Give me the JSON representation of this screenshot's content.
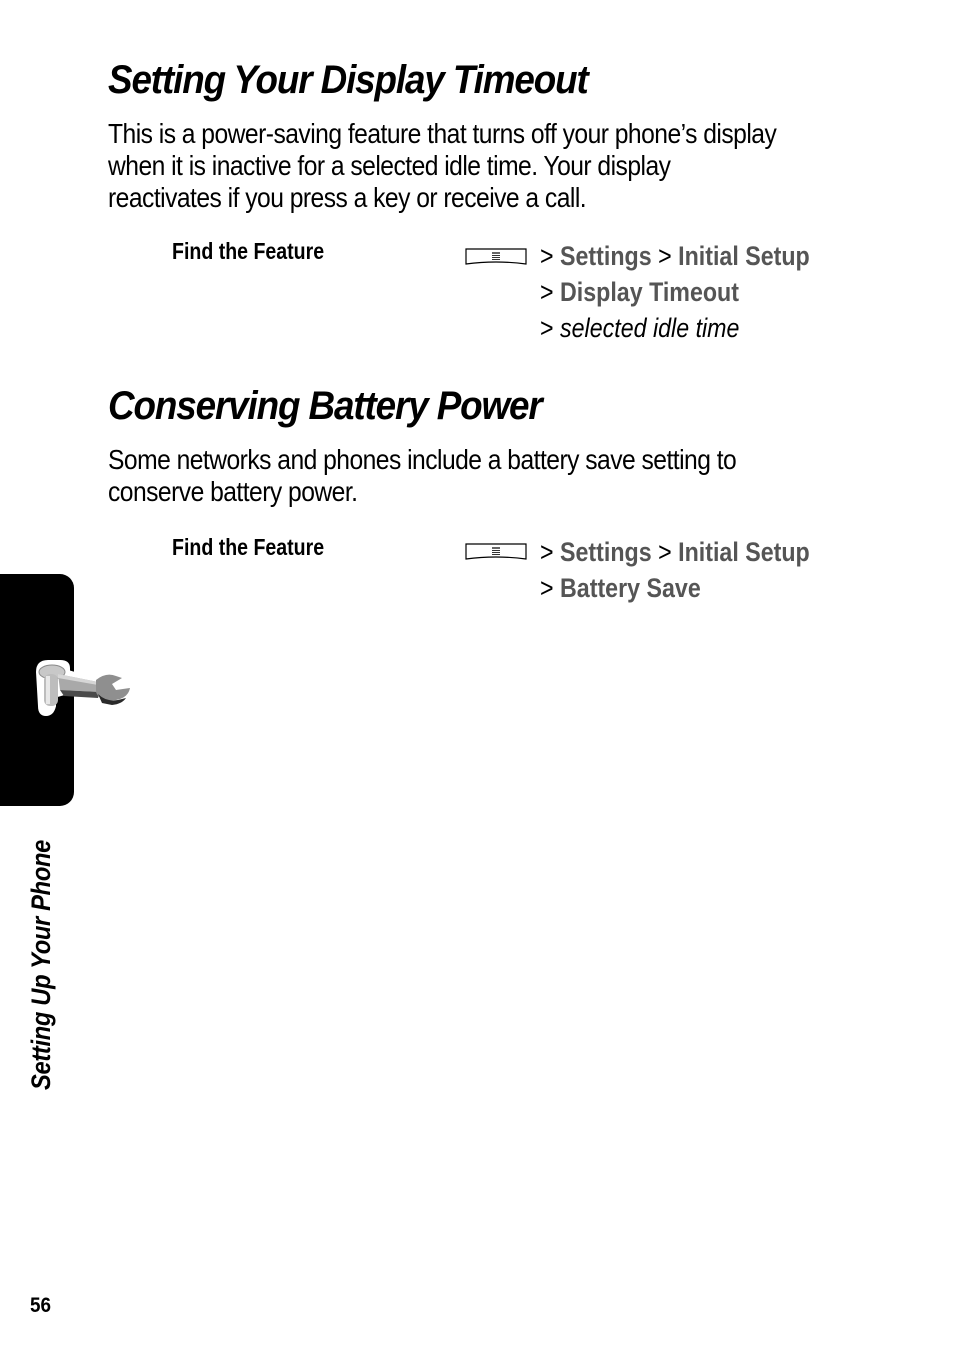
{
  "sections": [
    {
      "title": "Setting Your Display Timeout",
      "body_lines": [
        "This is a power-saving feature that turns off your phone’s display",
        "when it is inactive for a selected idle time. Your display",
        "reactivates if you press a key or receive a call."
      ],
      "find_feature": {
        "label": "Find the Feature",
        "key_icon": "menu-key-icon",
        "path": [
          {
            "type": "item",
            "text": "Settings"
          },
          {
            "type": "item",
            "text": "Initial Setup"
          },
          {
            "type": "item",
            "text": "Display Timeout"
          },
          {
            "type": "variable",
            "text": "selected idle time"
          }
        ]
      }
    },
    {
      "title": "Conserving Battery Power",
      "body_lines": [
        "Some networks and phones include a battery save setting to",
        "conserve battery power."
      ],
      "find_feature": {
        "label": "Find the Feature",
        "key_icon": "menu-key-icon",
        "path": [
          {
            "type": "item",
            "text": "Settings"
          },
          {
            "type": "item",
            "text": "Initial Setup"
          },
          {
            "type": "item",
            "text": "Battery Save"
          }
        ]
      }
    }
  ],
  "separator": ">",
  "side_tab": {
    "icon": "wrench-icon",
    "label": "Setting Up Your Phone"
  },
  "page_number": "56",
  "colors": {
    "menu_item": "#555555",
    "tab_background": "#000000"
  }
}
